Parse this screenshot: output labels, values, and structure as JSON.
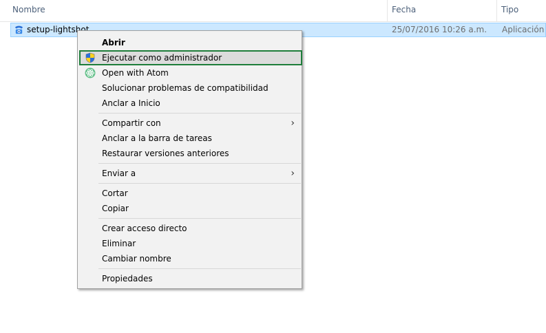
{
  "columns": {
    "name": "Nombre",
    "date": "Fecha",
    "type": "Tipo",
    "sort_indicator": "^"
  },
  "file": {
    "name": "setup-lightshot",
    "date": "25/07/2016 10:26 a.m.",
    "type": "Aplicación",
    "icon": "lightshot-app-icon"
  },
  "context_menu": {
    "open": "Abrir",
    "run_as_admin": "Ejecutar como administrador",
    "open_with_atom": "Open with Atom",
    "troubleshoot": "Solucionar problemas de compatibilidad",
    "pin_start": "Anclar a Inicio",
    "share_with": "Compartir con",
    "pin_taskbar": "Anclar a la barra de tareas",
    "restore_versions": "Restaurar versiones anteriores",
    "send_to": "Enviar a",
    "cut": "Cortar",
    "copy": "Copiar",
    "create_shortcut": "Crear acceso directo",
    "delete": "Eliminar",
    "rename": "Cambiar nombre",
    "properties": "Propiedades",
    "submenu_chevron": "›"
  },
  "colors": {
    "selection_bg": "#cce8ff",
    "highlight_border": "#1e7d3a",
    "header_text": "#4c607a"
  }
}
